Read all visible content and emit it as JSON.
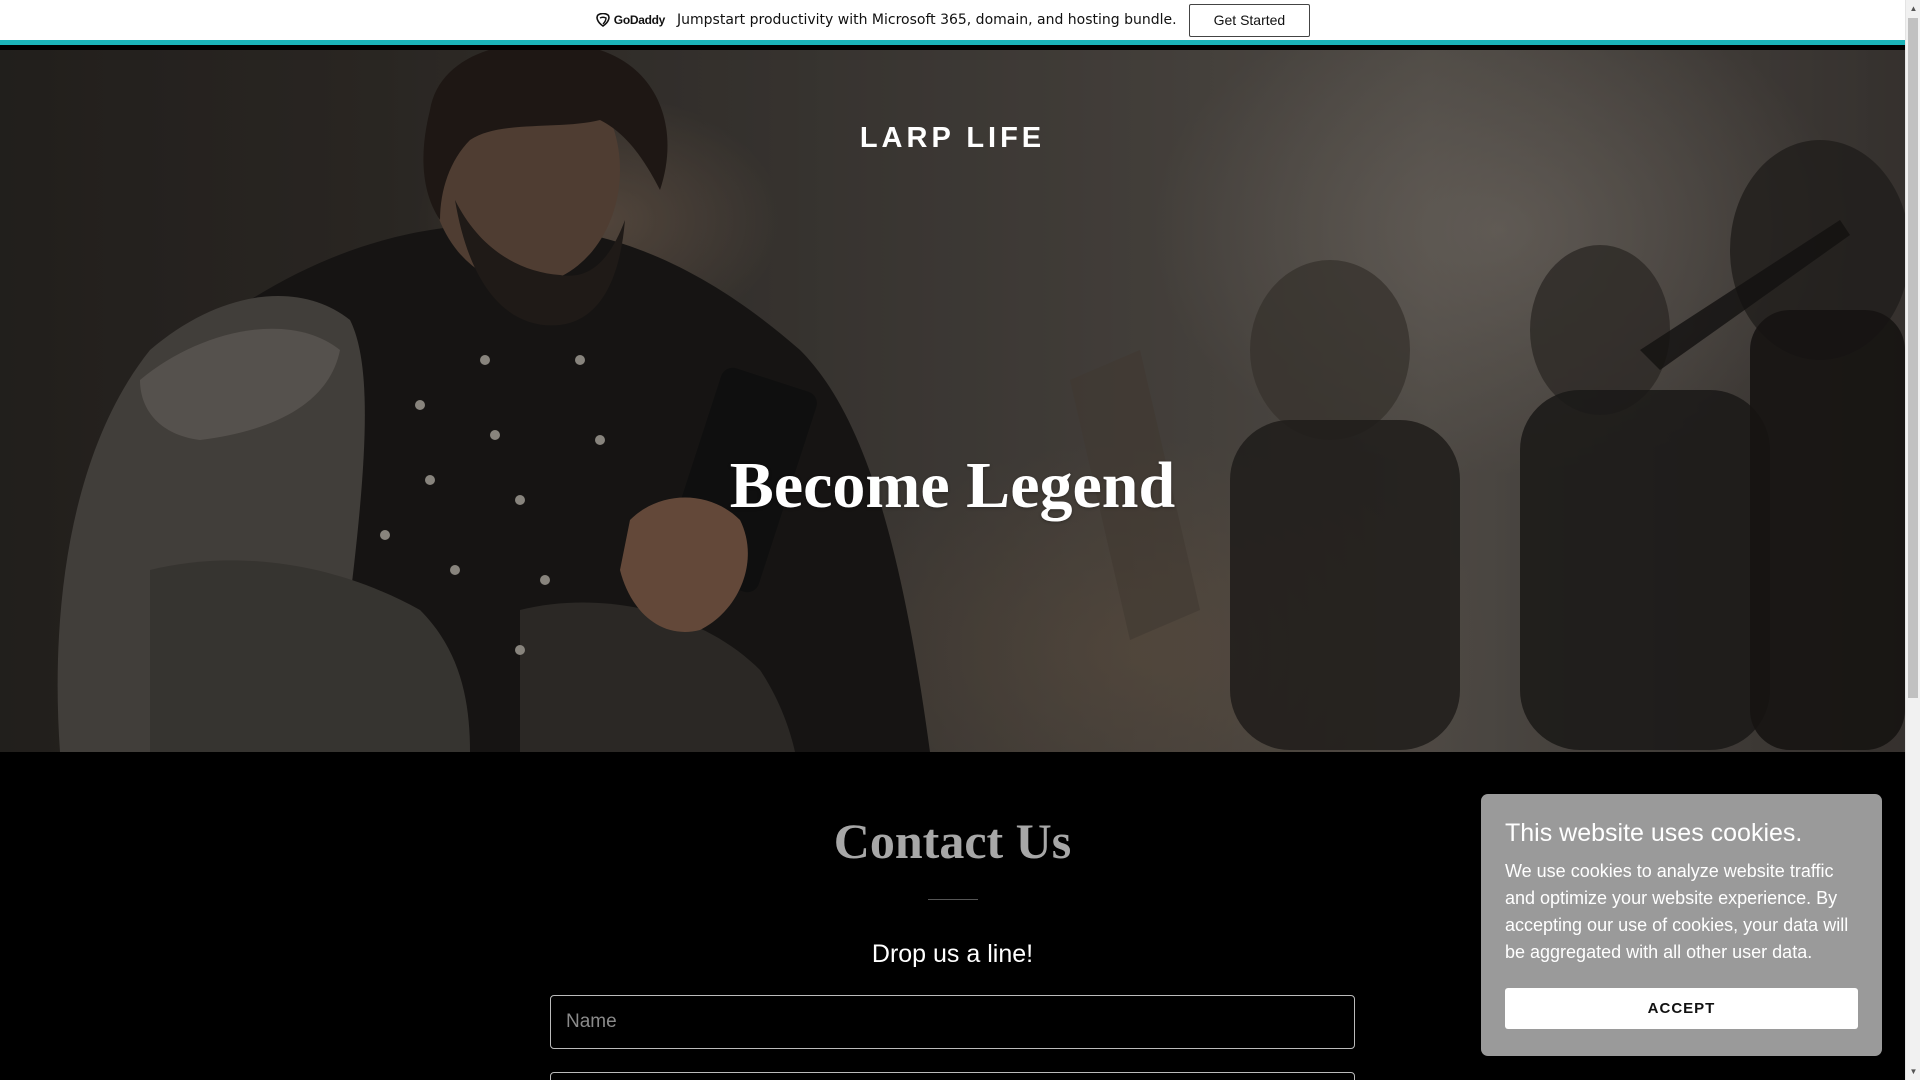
{
  "promo": {
    "logo_text": "GoDaddy",
    "message": "Jumpstart productivity with Microsoft 365, domain, and hosting bundle.",
    "cta_label": "Get Started"
  },
  "hero": {
    "site_title": "LARP LIFE",
    "heading": "Become Legend"
  },
  "contact": {
    "title": "Contact Us",
    "subtitle": "Drop us a line!",
    "name_placeholder": "Name",
    "email_placeholder": ""
  },
  "cookie_banner": {
    "title": "This website uses cookies.",
    "body": "We use cookies to analyze website traffic and optimize your website experience. By accepting our use of cookies, your data will be aggregated with all other user data.",
    "accept_label": "ACCEPT"
  },
  "colors": {
    "promo_accent": "#1bb3b8",
    "cookie_bg": "#9a9a9a",
    "contact_title": "#a7a7a7"
  },
  "icons": {
    "promo_logo": "godaddy-logo-icon",
    "scroll_up": "scroll-up-arrow-icon",
    "scroll_down": "scroll-down-arrow-icon"
  }
}
